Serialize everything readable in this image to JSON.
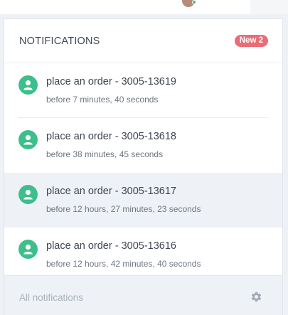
{
  "header": {
    "title": "NOTIFICATIONS",
    "badge_text": "New 2"
  },
  "notifications": [
    {
      "title": "place an order - 3005-13619",
      "time": "before 7 minutes, 40 seconds",
      "highlighted": false,
      "icon": "user-icon"
    },
    {
      "title": "place an order - 3005-13618",
      "time": "before 38 minutes, 45 seconds",
      "highlighted": false,
      "icon": "user-icon"
    },
    {
      "title": "place an order - 3005-13617",
      "time": "before 12 hours, 27 minutes, 23 seconds",
      "highlighted": true,
      "icon": "user-icon"
    },
    {
      "title": "place an order - 3005-13616",
      "time": "before 12 hours, 42 minutes, 40 seconds",
      "highlighted": false,
      "icon": "user-icon"
    }
  ],
  "footer": {
    "link_label": "All notifications",
    "settings_icon": "gear-icon"
  },
  "colors": {
    "badge": "#ed6b75",
    "avatar": "#3dbf8b",
    "highlight": "#eef2f6"
  }
}
